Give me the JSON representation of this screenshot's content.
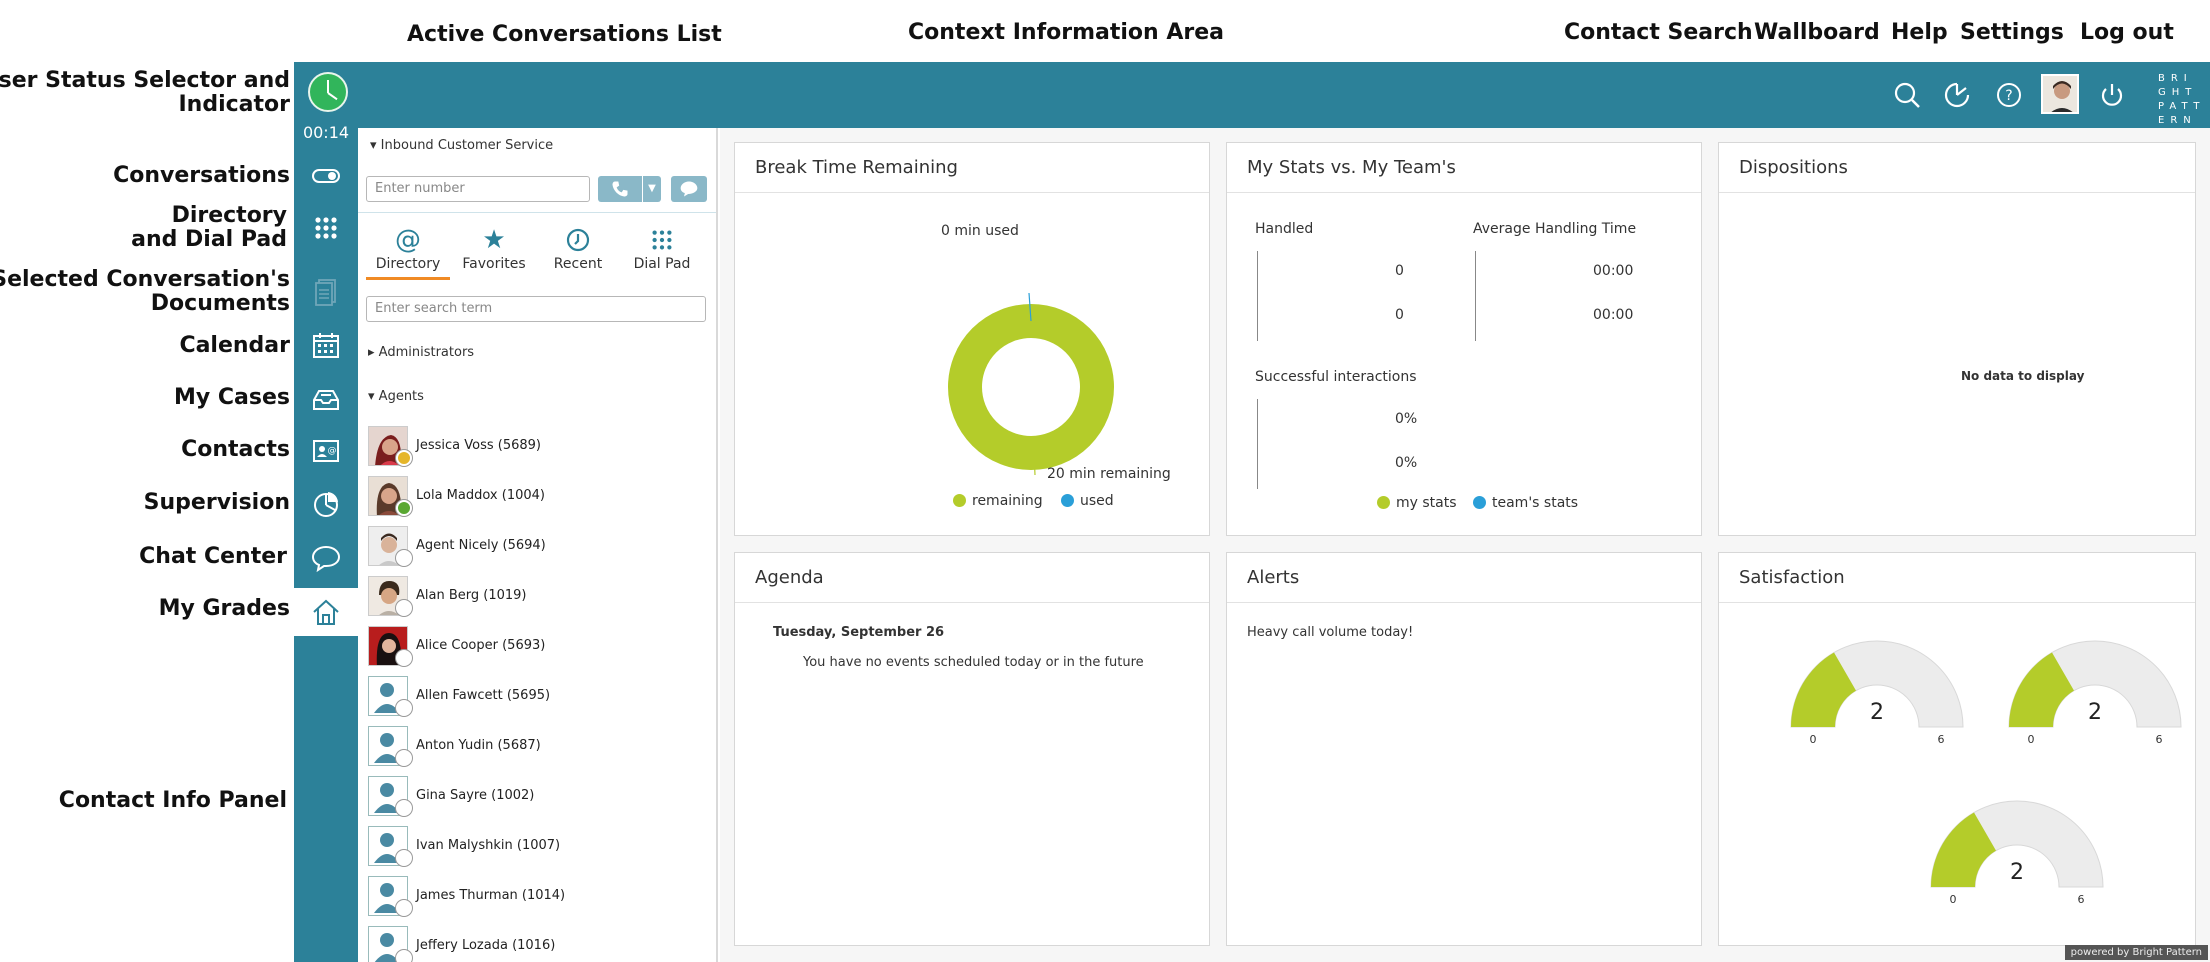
{
  "annotations": {
    "active_conversations_list": "Active Conversations List",
    "context_information_area": "Context Information Area",
    "contact_search": "Contact Search",
    "wallboard": "Wallboard",
    "help": "Help",
    "settings": "Settings",
    "log_out": "Log out",
    "user_status_line1": "User Status Selector and",
    "user_status_line2": "Indicator",
    "conversations": "Conversations",
    "directory_line1": "Directory",
    "directory_line2": "and Dial Pad",
    "documents_line1": "Selected Conversation's",
    "documents_line2": "Documents",
    "calendar": "Calendar",
    "my_cases": "My Cases",
    "contacts": "Contacts",
    "supervision": "Supervision",
    "chat_center": "Chat Center",
    "my_grades": "My Grades",
    "contact_info_panel": "Contact Info Panel"
  },
  "status": {
    "timer": "00:14"
  },
  "brand": {
    "text": "BRIGHTPATTERN"
  },
  "conversation_panel": {
    "queue": "Inbound Customer Service",
    "number_placeholder": "Enter number",
    "tabs": [
      {
        "label": "Directory",
        "icon": "at-icon"
      },
      {
        "label": "Favorites",
        "icon": "star-icon"
      },
      {
        "label": "Recent",
        "icon": "recent-icon"
      },
      {
        "label": "Dial Pad",
        "icon": "dialpad-icon"
      }
    ],
    "search_placeholder": "Enter search term",
    "groups": {
      "administrators": "Administrators",
      "agents": "Agents"
    },
    "agents": [
      {
        "name": "Jessica Voss (5689)",
        "status": "away"
      },
      {
        "name": "Lola Maddox (1004)",
        "status": "ready"
      },
      {
        "name": "Agent Nicely (5694)",
        "status": "offline"
      },
      {
        "name": "Alan Berg (1019)",
        "status": "offline"
      },
      {
        "name": "Alice Cooper (5693)",
        "status": "offline"
      },
      {
        "name": "Allen Fawcett (5695)",
        "status": "offline"
      },
      {
        "name": "Anton Yudin (5687)",
        "status": "offline"
      },
      {
        "name": "Gina Sayre (1002)",
        "status": "offline"
      },
      {
        "name": "Ivan Malyshkin (1007)",
        "status": "offline"
      },
      {
        "name": "James Thurman (1014)",
        "status": "offline"
      },
      {
        "name": "Jeffery Lozada (1016)",
        "status": "offline"
      }
    ]
  },
  "widgets": {
    "break_time": {
      "title": "Break Time Remaining",
      "used_label": "0 min used",
      "remaining_label": "20 min remaining",
      "legend_remaining": "remaining",
      "legend_used": "used",
      "used_minutes": 0,
      "remaining_minutes": 20
    },
    "my_stats": {
      "title": "My Stats vs. My Team's",
      "handled": "Handled",
      "handled_mine": "0",
      "handled_team": "0",
      "aht": "Average Handling Time",
      "aht_mine": "00:00",
      "aht_team": "00:00",
      "successful": "Successful interactions",
      "succ_mine": "0%",
      "succ_team": "0%",
      "legend_mine": "my stats",
      "legend_team": "team's stats"
    },
    "dispositions": {
      "title": "Dispositions",
      "empty": "No data to display"
    },
    "agenda": {
      "title": "Agenda",
      "date": "Tuesday, September 26",
      "message": "You have no events scheduled today or in the future"
    },
    "alerts": {
      "title": "Alerts",
      "message": "Heavy call volume today!"
    },
    "satisfaction": {
      "title": "Satisfaction",
      "gauges": [
        {
          "value": 2,
          "min": 0,
          "max": 6
        },
        {
          "value": 2,
          "min": 0,
          "max": 6
        },
        {
          "value": 2,
          "min": 0,
          "max": 6
        }
      ]
    }
  },
  "footer": {
    "powered": "powered by Bright Pattern"
  },
  "colors": {
    "chrome": "#2c8199",
    "green": "#b4cc2a",
    "blue": "#2a9fd8",
    "status_green": "#31b55b",
    "accent": "#f08a24"
  }
}
